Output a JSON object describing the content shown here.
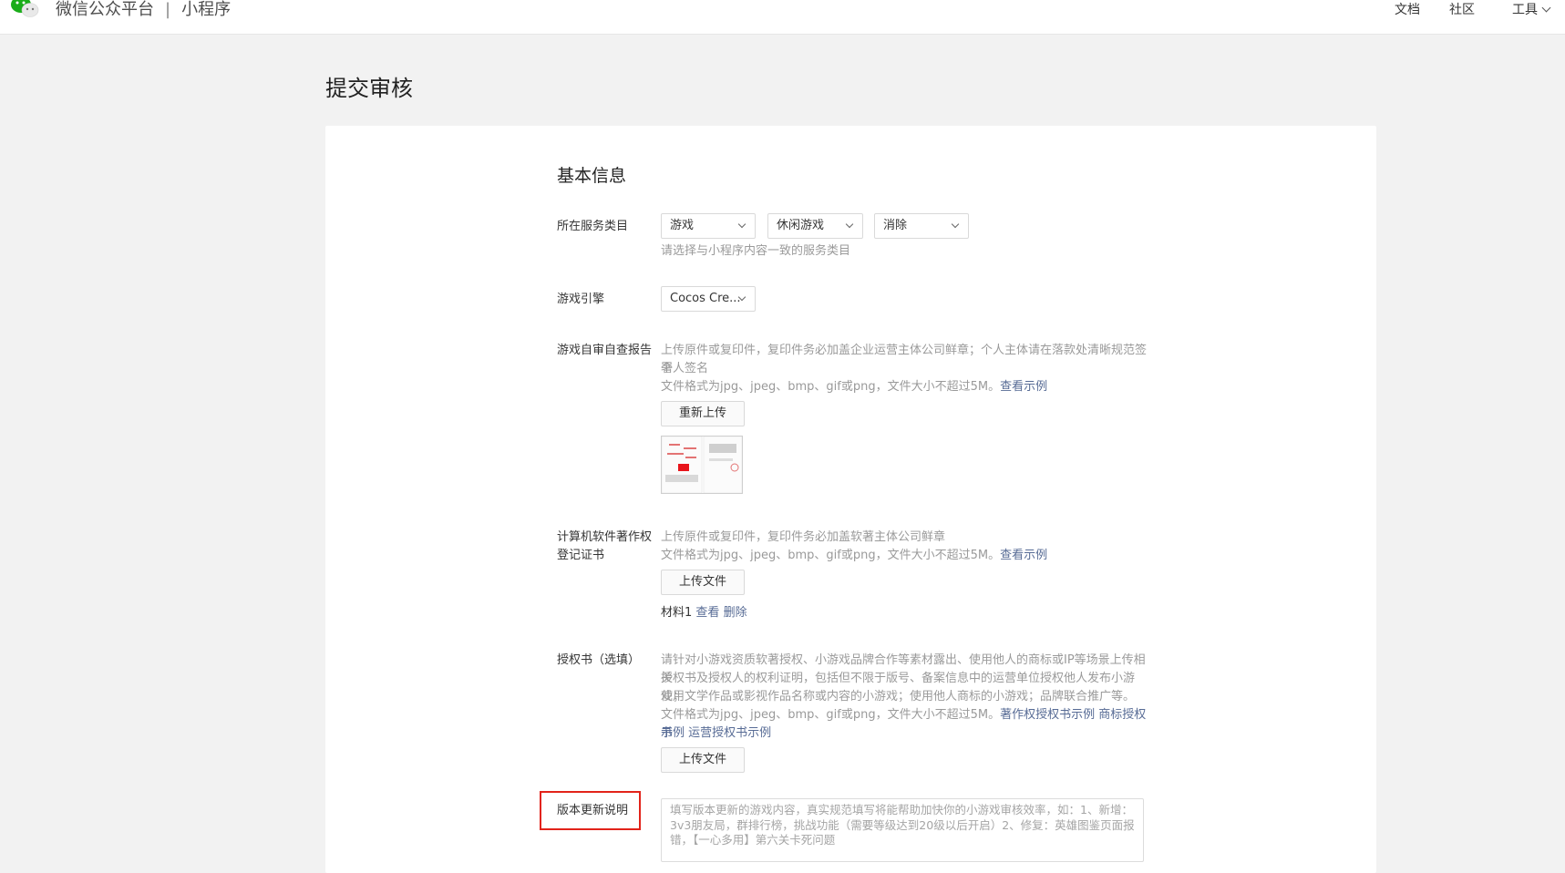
{
  "header": {
    "brand": "微信公众平台",
    "separator": "|",
    "product": "小程序",
    "nav": {
      "docs": "文档",
      "community": "社区",
      "tools": "工具"
    }
  },
  "page": {
    "title": "提交审核"
  },
  "form": {
    "section_title": "基本信息",
    "service_category": {
      "label": "所在服务类目",
      "selects": [
        "游戏",
        "休闲游戏",
        "消除"
      ],
      "help": "请选择与小程序内容一致的服务类目"
    },
    "engine": {
      "label": "游戏引擎",
      "value": "Cocos Cre..."
    },
    "self_report": {
      "label": "游戏自审自查报告",
      "help_line1": "上传原件或复印件，复印件务必加盖企业运营主体公司鲜章；个人主体请在落款处清晰规范签署",
      "help_line2": "个人签名",
      "format_text": "文件格式为jpg、jpeg、bmp、gif或png，文件大小不超过5M。",
      "example_link": "查看示例",
      "reupload_button": "重新上传"
    },
    "copyright": {
      "label_line1": "计算机软件著作权",
      "label_line2": "登记证书",
      "help_line1": "上传原件或复印件，复印件务必加盖软著主体公司鲜章",
      "format_text": "文件格式为jpg、jpeg、bmp、gif或png，文件大小不超过5M。",
      "example_link": "查看示例",
      "upload_button": "上传文件",
      "material_name": "材料1",
      "view_link": "查看",
      "delete_link": "删除"
    },
    "authorization": {
      "label": "授权书（选填）",
      "help_line1": "请针对小游戏资质软著授权、小游戏品牌合作等素材露出、使用他人的商标或IP等场景上传相关",
      "help_line2": "授权书及授权人的权利证明，包括但不限于版号、备案信息中的运营单位授权他人发布小游戏；",
      "help_line3": "使用文学作品或影视作品名称或内容的小游戏；使用他人商标的小游戏；品牌联合推广等。",
      "format_text": "文件格式为jpg、jpeg、bmp、gif或png，文件大小不超过5M。",
      "link1": "著作权授权书示例",
      "link2_part1": "商标授权书",
      "link2_part2": "示例",
      "link3": "运营授权书示例",
      "upload_button": "上传文件"
    },
    "release_notes": {
      "label": "版本更新说明",
      "placeholder": "填写版本更新的游戏内容，真实规范填写将能帮助加快你的小游戏审核效率，如：1、新增：3v3朋友局，群排行榜，挑战功能（需要等级达到20级以后开启）2、修复：英雄图鉴页面报错，【一心多用】第六关卡死问题"
    }
  },
  "colors": {
    "link": "#576b95",
    "highlight_border": "#e2231a",
    "background": "#f2f2f2",
    "card": "#ffffff"
  }
}
